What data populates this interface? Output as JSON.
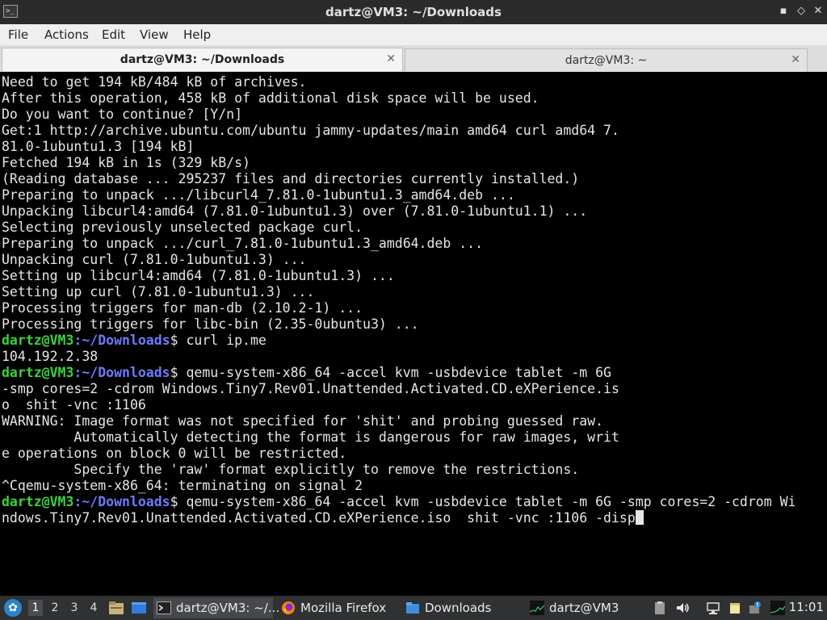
{
  "window": {
    "title": "dartz@VM3: ~/Downloads",
    "minimize": "▪",
    "maximize": "◇",
    "close": "✕"
  },
  "menu": [
    "File",
    "Actions",
    "Edit",
    "View",
    "Help"
  ],
  "tabs": [
    {
      "label": "dartz@VM3: ~/Downloads",
      "close": "✕"
    },
    {
      "label": "dartz@VM3: ~",
      "close": "✕"
    }
  ],
  "terminal": {
    "prompt_user": "dartz@VM3",
    "prompt_path": ":~/Downloads",
    "prompt_sep": "$ ",
    "lines": [
      {
        "text": "Need to get 194 kB/484 kB of archives."
      },
      {
        "text": "After this operation, 458 kB of additional disk space will be used."
      },
      {
        "text": "Do you want to continue? [Y/n]"
      },
      {
        "text": "Get:1 http://archive.ubuntu.com/ubuntu jammy-updates/main amd64 curl amd64 7."
      },
      {
        "text": "81.0-1ubuntu1.3 [194 kB]"
      },
      {
        "text": "Fetched 194 kB in 1s (329 kB/s)"
      },
      {
        "text": "(Reading database ... 295237 files and directories currently installed.)"
      },
      {
        "text": "Preparing to unpack .../libcurl4_7.81.0-1ubuntu1.3_amd64.deb ..."
      },
      {
        "text": "Unpacking libcurl4:amd64 (7.81.0-1ubuntu1.3) over (7.81.0-1ubuntu1.1) ..."
      },
      {
        "text": "Selecting previously unselected package curl."
      },
      {
        "text": "Preparing to unpack .../curl_7.81.0-1ubuntu1.3_amd64.deb ..."
      },
      {
        "text": "Unpacking curl (7.81.0-1ubuntu1.3) ..."
      },
      {
        "text": "Setting up libcurl4:amd64 (7.81.0-1ubuntu1.3) ..."
      },
      {
        "text": "Setting up curl (7.81.0-1ubuntu1.3) ..."
      },
      {
        "text": "Processing triggers for man-db (2.10.2-1) ..."
      },
      {
        "text": "Processing triggers for libc-bin (2.35-0ubuntu3) ..."
      },
      {
        "prompt": true,
        "text": "curl ip.me"
      },
      {
        "text": "104.192.2.38"
      },
      {
        "prompt": true,
        "text": "qemu-system-x86_64 -accel kvm -usbdevice tablet -m 6G"
      },
      {
        "text": "-smp cores=2 -cdrom Windows.Tiny7.Rev01.Unattended.Activated.CD.eXPerience.is"
      },
      {
        "text": "o  shit -vnc :1106"
      },
      {
        "text": "WARNING: Image format was not specified for 'shit' and probing guessed raw."
      },
      {
        "text": "         Automatically detecting the format is dangerous for raw images, writ"
      },
      {
        "text": "e operations on block 0 will be restricted."
      },
      {
        "text": "         Specify the 'raw' format explicitly to remove the restrictions."
      },
      {
        "text": "^Cqemu-system-x86_64: terminating on signal 2"
      },
      {
        "prompt": true,
        "text": "qemu-system-x86_64 -accel kvm -usbdevice tablet -m 6G -smp cores=2 -cdrom Wi"
      },
      {
        "text": "ndows.Tiny7.Rev01.Unattended.Activated.CD.eXPerience.iso  shit -vnc :1106 -disp",
        "cursor": true
      }
    ]
  },
  "taskbar": {
    "workspaces": [
      "1",
      "2",
      "3",
      "4"
    ],
    "tasks": [
      {
        "label": "dartz@VM3: ~/...",
        "icon": "terminal-icon"
      },
      {
        "label": "Mozilla Firefox",
        "icon": "firefox-icon"
      },
      {
        "label": "Downloads",
        "icon": "folder-icon"
      },
      {
        "label": "dartz@VM3",
        "icon": "cpu-monitor-icon"
      }
    ],
    "clock": "11:01"
  },
  "colors": {
    "prompt_user": "#3cd23c",
    "prompt_path": "#6d7bff",
    "terminal_bg": "#000000",
    "terminal_fg": "#e6e6e6"
  }
}
